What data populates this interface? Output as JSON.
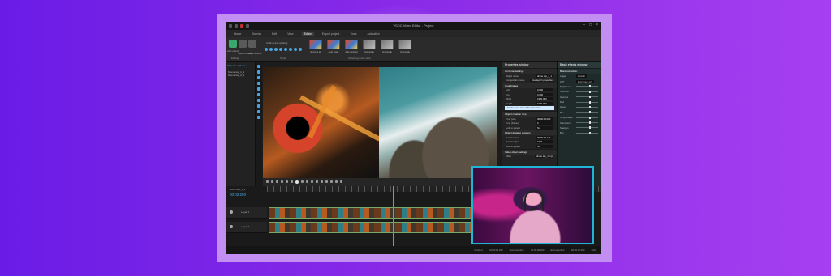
{
  "app": {
    "title": "VSDC Video Editor - Project",
    "menu": [
      "Home",
      "Scenes",
      "Edit",
      "View",
      "Editor",
      "Export project",
      "Tools",
      "Activation"
    ],
    "active_menu": "Editor"
  },
  "ribbon": {
    "left_buttons": [
      "Add object",
      "Video effects",
      "Audio effects"
    ],
    "editing_group": "Editing",
    "cutting_label": "Cutting and splitting",
    "tools_group": "Tools",
    "quick_styles_group": "Choosing quick style",
    "effects": [
      "Remove all",
      "Auto levels",
      "Auto contrast",
      "Grayscale",
      "Grayscale",
      "Grayscale"
    ]
  },
  "left_panel": {
    "tab": "Projects explorer",
    "items": [
      "Scene tap_1_1",
      "Scene tap_2_1"
    ]
  },
  "properties": {
    "title": "Properties window",
    "sections": {
      "common": "Common settings",
      "coordinates": "Coordinates",
      "creation": "Object creation time",
      "drawing": "Object drawing duration",
      "video": "Video object settings"
    },
    "rows": [
      {
        "k": "Object name",
        "v": "drone tap_1_1"
      },
      {
        "k": "Composition mode",
        "v": "Use layer's properties"
      },
      {
        "k": "Left",
        "v": "0.000"
      },
      {
        "k": "Top",
        "v": "0.000"
      },
      {
        "k": "Width",
        "v": "1920.000"
      },
      {
        "k": "Height",
        "v": "1080.000"
      }
    ],
    "set_same_size": "Set the same size as the parent has",
    "time_rows": [
      {
        "k": "Time (ms)",
        "v": "00:00:00.000"
      },
      {
        "k": "Time (frame)",
        "v": "0"
      },
      {
        "k": "Lock to parent",
        "v": "No"
      },
      {
        "k": "Duration (ms)",
        "v": "00:00:35.120"
      },
      {
        "k": "Duration (fps)",
        "v": "1069"
      },
      {
        "k": "Lock to parent",
        "v": "No"
      },
      {
        "k": "Video",
        "v": "drone tap_1.mp4"
      }
    ]
  },
  "basic_effects": {
    "title": "Basic effects window",
    "section": "Basic correction",
    "preset": "Default",
    "lut_value": "Don't use LUT",
    "labels": [
      "Angle",
      "LUT",
      "Brightness",
      "Contrast",
      "Gamma",
      "Red",
      "Green",
      "Blue",
      "Temperature",
      "Saturation",
      "Sharpen",
      "Blur"
    ]
  },
  "timeline": {
    "scene": "drone tap_1_1",
    "timecode": "00:02.250",
    "tracks": [
      {
        "label": "Layer 1"
      },
      {
        "label": "Layer 2"
      }
    ]
  },
  "status": {
    "position": "Position:",
    "position_val": "00:00:12.250",
    "start_sel": "Start selection:",
    "start_val": "00:00:00.000",
    "end_sel": "End selection:",
    "end_val": "00:00:00.000",
    "zoom": "14%"
  },
  "colors": {
    "background_start": "#6a1ce6",
    "background_end": "#a63ff0",
    "frame": "#c28ef2",
    "accent": "#1fb6d6"
  }
}
